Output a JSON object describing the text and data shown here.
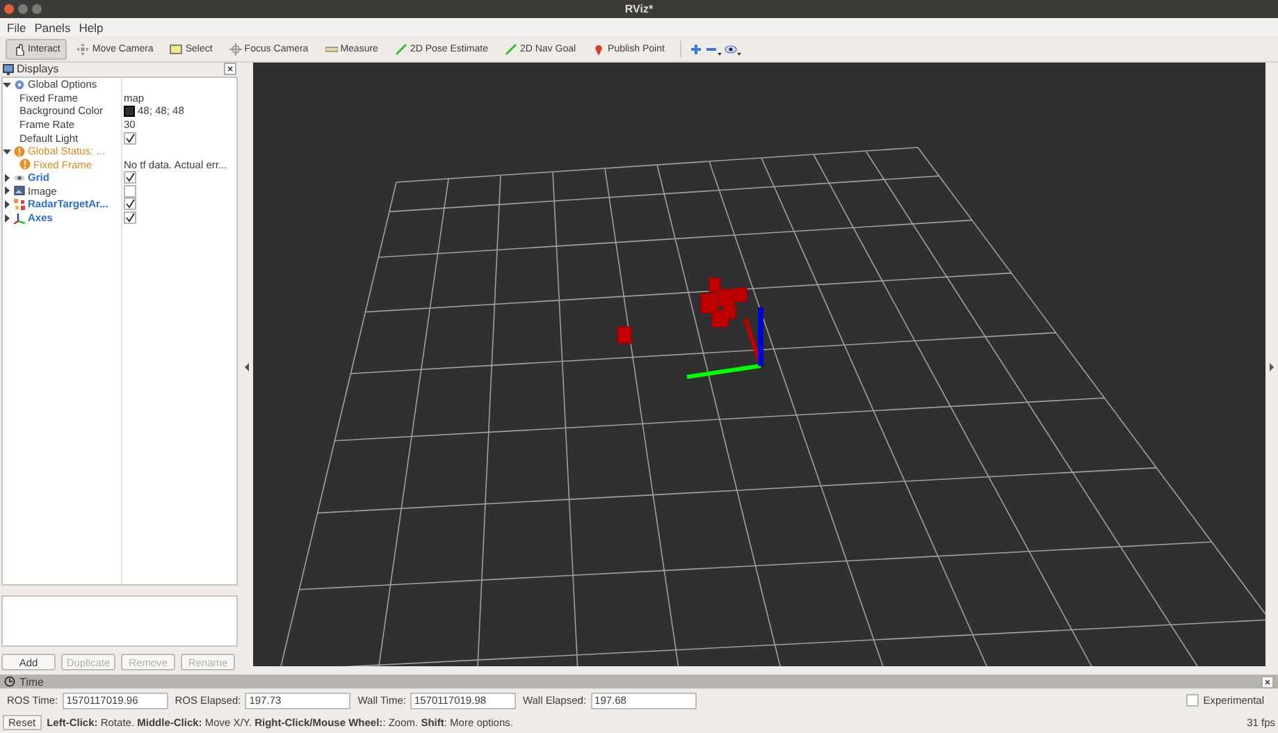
{
  "window": {
    "title": "RViz*"
  },
  "menu": [
    "File",
    "Panels",
    "Help"
  ],
  "tools": [
    {
      "label": "Interact",
      "kind": "interact",
      "selected": true
    },
    {
      "label": "Move Camera",
      "kind": "move",
      "selected": false
    },
    {
      "label": "Select",
      "kind": "select",
      "selected": false
    },
    {
      "label": "Focus Camera",
      "kind": "focus",
      "selected": false
    },
    {
      "label": "Measure",
      "kind": "measure",
      "selected": false
    },
    {
      "label": "2D Pose Estimate",
      "kind": "pose",
      "selected": false
    },
    {
      "label": "2D Nav Goal",
      "kind": "goal",
      "selected": false
    },
    {
      "label": "Publish Point",
      "kind": "point",
      "selected": false
    }
  ],
  "displays": {
    "title": "Displays",
    "items": [
      {
        "label": "Global Options",
        "kind": "options",
        "expanded": true,
        "children": [
          {
            "label": "Fixed Frame",
            "kind": "text",
            "value": "map"
          },
          {
            "label": "Background Color",
            "kind": "color",
            "value": "48; 48; 48",
            "color": "#303030"
          },
          {
            "label": "Frame Rate",
            "kind": "text",
            "value": "30"
          },
          {
            "label": "Default Light",
            "kind": "check",
            "checked": true
          }
        ]
      },
      {
        "label": "Global Status: ...",
        "kind": "warning",
        "expanded": true,
        "children": [
          {
            "label": "Fixed Frame",
            "kind": "warning",
            "value": "No tf data.  Actual err..."
          }
        ]
      },
      {
        "label": "Grid",
        "kind": "grid",
        "expanded": false,
        "checked": true
      },
      {
        "label": "Image",
        "kind": "image",
        "expanded": false,
        "checked": false
      },
      {
        "label": "RadarTargetAr...",
        "kind": "markers",
        "expanded": false,
        "checked": true
      },
      {
        "label": "Axes",
        "kind": "axes",
        "expanded": false,
        "checked": true
      }
    ],
    "buttons": [
      {
        "label": "Add",
        "disabled": false
      },
      {
        "label": "Duplicate",
        "disabled": true
      },
      {
        "label": "Remove",
        "disabled": true
      },
      {
        "label": "Rename",
        "disabled": true
      }
    ]
  },
  "time": {
    "title": "Time",
    "fields": [
      {
        "label": "ROS Time:",
        "value": "1570117019.96"
      },
      {
        "label": "ROS Elapsed:",
        "value": "197.73"
      },
      {
        "label": "Wall Time:",
        "value": "1570117019.98"
      },
      {
        "label": "Wall Elapsed:",
        "value": "197.68"
      }
    ],
    "experimental": {
      "label": "Experimental",
      "checked": false
    }
  },
  "status_bar": {
    "button": "Reset",
    "hint": "**Left-Click:** Rotate. **Middle-Click:** Move X/Y. **Right-Click/Mouse Wheel:**: Zoom. **Shift**: More options.",
    "fps": "31 fps"
  }
}
